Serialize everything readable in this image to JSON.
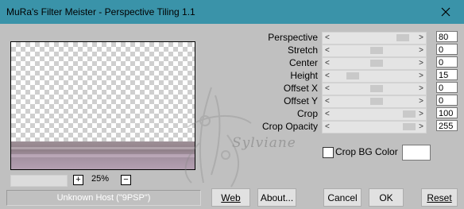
{
  "window": {
    "title": "MuRa's Filter Meister - Perspective Tiling 1.1",
    "titlebar_color": "#3a93a9"
  },
  "icons": {
    "close": "close-icon",
    "left_arrow": "chevron-left-icon",
    "right_arrow": "chevron-right-icon"
  },
  "zoom": {
    "plus": "+",
    "minus": "−",
    "value": "25%"
  },
  "status": {
    "text": "Unknown Host (\"9PSP\")"
  },
  "params": [
    {
      "label": "Perspective",
      "value": "80"
    },
    {
      "label": "Stretch",
      "value": "0"
    },
    {
      "label": "Center",
      "value": "0"
    },
    {
      "label": "Height",
      "value": "15"
    },
    {
      "label": "Offset X",
      "value": "0"
    },
    {
      "label": "Offset Y",
      "value": "0"
    },
    {
      "label": "Crop",
      "value": "100"
    },
    {
      "label": "Crop Opacity",
      "value": "255"
    }
  ],
  "crop_bg": {
    "label": "Crop BG Color",
    "checked": false,
    "color": "#ffffff"
  },
  "buttons": {
    "web": "Web",
    "about": "About...",
    "cancel": "Cancel",
    "ok": "OK",
    "reset": "Reset"
  },
  "watermark": {
    "text": "Sylviane"
  }
}
